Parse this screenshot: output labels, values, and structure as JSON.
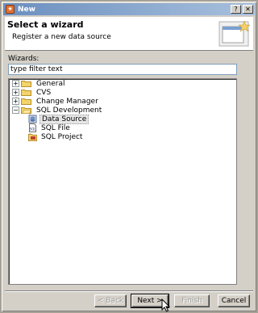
{
  "window": {
    "title": "New",
    "controls": [
      "?",
      "✕"
    ]
  },
  "header": {
    "title": "Select a wizard",
    "description": "Register a new data source"
  },
  "wizards": {
    "label": "Wizards:",
    "filter_placeholder": "type filter text",
    "filter_value": "type filter text",
    "tree": [
      {
        "label": "General",
        "expander": "+"
      },
      {
        "label": "CVS",
        "expander": "+"
      },
      {
        "label": "Change Manager",
        "expander": "+"
      },
      {
        "label": "SQL Development",
        "expander": "−"
      },
      {
        "label": "Data Source"
      },
      {
        "label": "SQL File"
      },
      {
        "label": "SQL Project"
      }
    ]
  },
  "buttons": {
    "back": "< Back",
    "next": "Next >",
    "finish": "Finish",
    "cancel": "Cancel"
  },
  "icons": {
    "app": "eclipse-new-icon",
    "folder": "folder-icon",
    "datasource": "data-source-icon",
    "sqlfile": "sql-file-icon",
    "sqlproject": "sql-project-icon"
  }
}
